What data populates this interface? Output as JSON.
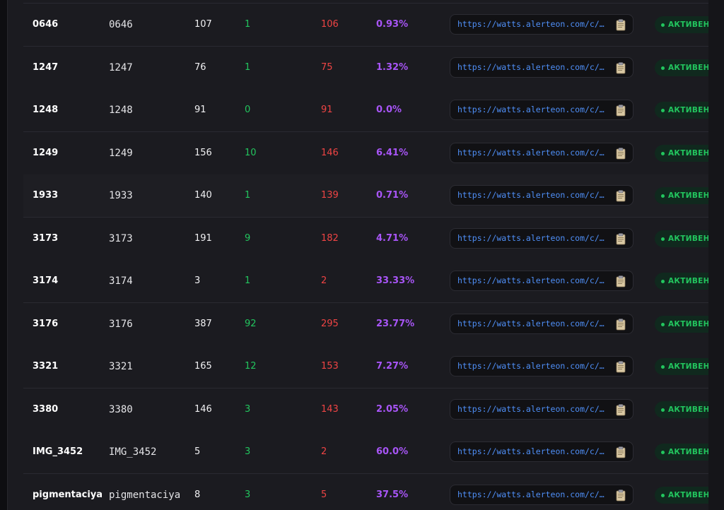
{
  "table": {
    "status_label": "АКТИВЕН",
    "rows": [
      {
        "name": "0646",
        "slug": "0646",
        "total": "107",
        "success": "1",
        "fail": "106",
        "rate": "0.93%",
        "link": "https://watts.alerteon.com/c/0…"
      },
      {
        "name": "1247",
        "slug": "1247",
        "total": "76",
        "success": "1",
        "fail": "75",
        "rate": "1.32%",
        "link": "https://watts.alerteon.com/c/1…"
      },
      {
        "name": "1248",
        "slug": "1248",
        "total": "91",
        "success": "0",
        "fail": "91",
        "rate": "0.0%",
        "link": "https://watts.alerteon.com/c/1…"
      },
      {
        "name": "1249",
        "slug": "1249",
        "total": "156",
        "success": "10",
        "fail": "146",
        "rate": "6.41%",
        "link": "https://watts.alerteon.com/c/1…"
      },
      {
        "name": "1933",
        "slug": "1933",
        "total": "140",
        "success": "1",
        "fail": "139",
        "rate": "0.71%",
        "link": "https://watts.alerteon.com/c/1…"
      },
      {
        "name": "3173",
        "slug": "3173",
        "total": "191",
        "success": "9",
        "fail": "182",
        "rate": "4.71%",
        "link": "https://watts.alerteon.com/c/3…"
      },
      {
        "name": "3174",
        "slug": "3174",
        "total": "3",
        "success": "1",
        "fail": "2",
        "rate": "33.33%",
        "link": "https://watts.alerteon.com/c/3…"
      },
      {
        "name": "3176",
        "slug": "3176",
        "total": "387",
        "success": "92",
        "fail": "295",
        "rate": "23.77%",
        "link": "https://watts.alerteon.com/c/3…"
      },
      {
        "name": "3321",
        "slug": "3321",
        "total": "165",
        "success": "12",
        "fail": "153",
        "rate": "7.27%",
        "link": "https://watts.alerteon.com/c/3…"
      },
      {
        "name": "3380",
        "slug": "3380",
        "total": "146",
        "success": "3",
        "fail": "143",
        "rate": "2.05%",
        "link": "https://watts.alerteon.com/c/3…"
      },
      {
        "name": "IMG_3452",
        "slug": "IMG_3452",
        "total": "5",
        "success": "3",
        "fail": "2",
        "rate": "60.0%",
        "link": "https://watts.alerteon.com/c/I…"
      },
      {
        "name": "pigmentaciya",
        "slug": "pigmentaciya",
        "total": "8",
        "success": "3",
        "fail": "5",
        "rate": "37.5%",
        "link": "https://watts.alerteon.com/c/p…"
      }
    ],
    "copy_icon": "clipboard-icon",
    "colors": {
      "success": "#22c55e",
      "fail": "#ef4444",
      "rate": "#a855f7",
      "link": "#4f8ff7",
      "badge_bg": "#10291e"
    }
  }
}
